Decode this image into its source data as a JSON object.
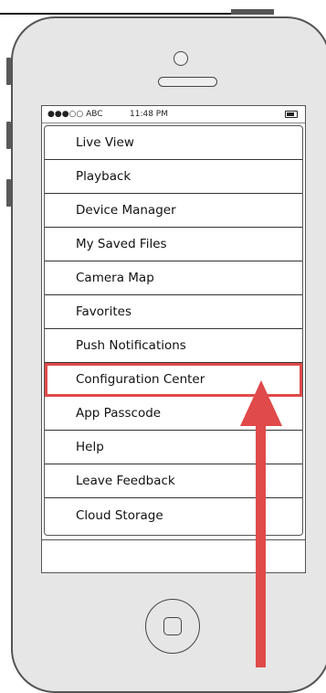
{
  "status_bar": {
    "carrier": "●●●○○ ABC",
    "time": "11:48 PM"
  },
  "menu": {
    "items": [
      "Live View",
      "Playback",
      "Device Manager",
      "My Saved Files",
      "Camera Map",
      "Favorites",
      "Push Notifications",
      "Configuration Center",
      "App Passcode",
      "Help",
      "Leave Feedback",
      "Cloud Storage"
    ],
    "highlighted": "Configuration Center"
  },
  "annotation": {
    "arrow_color": "#e04a4a",
    "highlight_color": "#e04a4a"
  },
  "icons": [
    "camera-icon",
    "speaker-icon",
    "battery-icon",
    "home-button-icon",
    "arrow-up-icon"
  ]
}
